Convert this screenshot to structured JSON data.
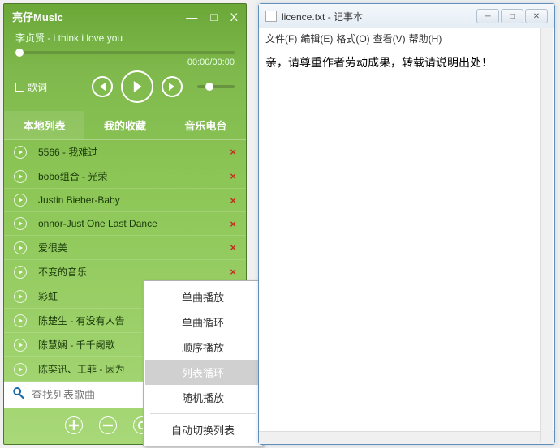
{
  "player": {
    "app_name": "亮仔Music",
    "now_playing": "李贞贤 - i think i love you",
    "time": "00:00/00:00",
    "lyrics_label": "歌词",
    "tabs": [
      "本地列表",
      "我的收藏",
      "音乐电台"
    ],
    "songs": [
      "5566 - 我难过",
      "bobo组合 - 光荣",
      "Justin Bieber-Baby",
      "onnor-Just One Last Dance",
      "爱很美",
      "不变的音乐",
      "彩虹",
      "陈楚生 - 有没有人告",
      "陈慧娴 - 千千阙歌",
      "陈奕迅、王菲 - 因为"
    ],
    "search_placeholder": "查找列表歌曲"
  },
  "context_menu": {
    "items": [
      "单曲播放",
      "单曲循环",
      "顺序播放",
      "列表循环",
      "随机播放"
    ],
    "separator_after": 4,
    "trailing": [
      "自动切换列表"
    ],
    "highlighted_index": 3
  },
  "notepad": {
    "title": "licence.txt - 记事本",
    "menus": [
      "文件(F)",
      "编辑(E)",
      "格式(O)",
      "查看(V)",
      "帮助(H)"
    ],
    "content": "亲，请尊重作者劳动成果，转载请说明出处！"
  }
}
